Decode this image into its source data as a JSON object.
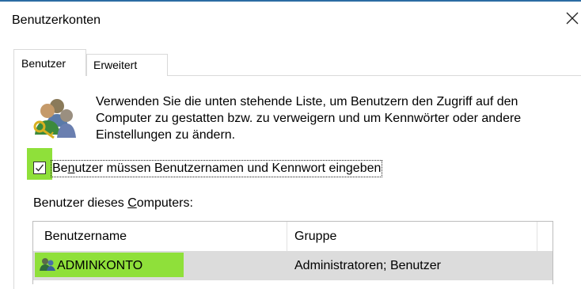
{
  "window": {
    "title": "Benutzerkonten",
    "close_icon": "close-icon"
  },
  "tabs": [
    {
      "label": "Benutzer",
      "active": true
    },
    {
      "label": "Erweitert",
      "active": false
    }
  ],
  "intro": {
    "icon": "users-key-icon",
    "text": "Verwenden Sie die unten stehende Liste, um Benutzern den Zugriff auf den Computer zu gestatten bzw. zu verweigern und um Kennwörter oder andere Einstellungen zu ändern."
  },
  "require_login": {
    "checked": true,
    "label_prefix": "Be",
    "label_mnemonic": "n",
    "label_suffix": "utzer müssen Benutzernamen und Kennwort eingeben",
    "highlight_color": "#8fe03a"
  },
  "users_section": {
    "label_prefix": "Benutzer dieses ",
    "label_mnemonic": "C",
    "label_suffix": "omputers:"
  },
  "user_table": {
    "columns": [
      "Benutzername",
      "Gruppe"
    ],
    "rows": [
      {
        "name": "ADMINKONTO",
        "group": "Administratoren; Benutzer",
        "icon": "user-icon",
        "selected": true
      }
    ]
  }
}
